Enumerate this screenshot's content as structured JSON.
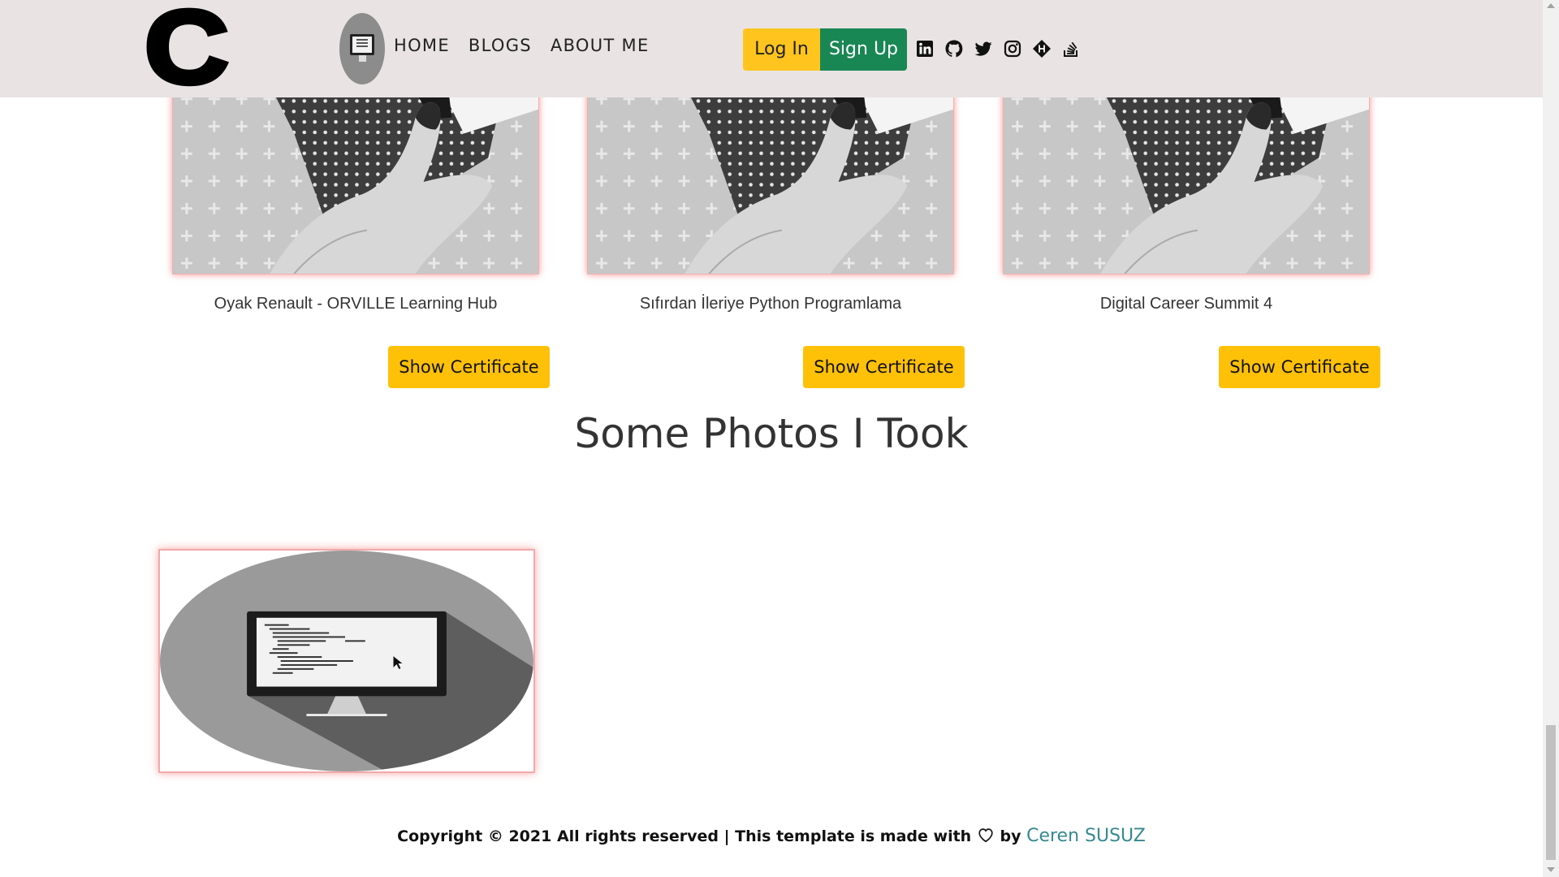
{
  "header": {
    "logo_text": "C",
    "avatar_icon": "computer-avatar-icon",
    "nav": [
      {
        "label": "HOME"
      },
      {
        "label": "BLOGS"
      },
      {
        "label": "ABOUT ME"
      }
    ],
    "login_label": "Log In",
    "signup_label": "Sign Up",
    "socials": [
      "linkedin-icon",
      "github-icon",
      "twitter-icon",
      "instagram-icon",
      "hashnode-icon",
      "stackoverflow-icon"
    ]
  },
  "certificates": [
    {
      "title": "Oyak Renault - ORVILLE Learning Hub",
      "button": "Show Certificate"
    },
    {
      "title": "Sıfırdan İleriye Python Programlama",
      "button": "Show Certificate"
    },
    {
      "title": "Digital Career Summit 4",
      "button": "Show Certificate"
    }
  ],
  "photos": {
    "title": "Some Photos I Took"
  },
  "footer": {
    "text": "Copyright © 2021 All rights reserved | This template is made with",
    "by": "by",
    "author": "Ceren SUSUZ"
  },
  "colors": {
    "header_bg": "#e9e3e3",
    "login": "#ffc51e",
    "signup": "#198754",
    "cert_button": "#ffc107",
    "author_link": "#35898f"
  }
}
